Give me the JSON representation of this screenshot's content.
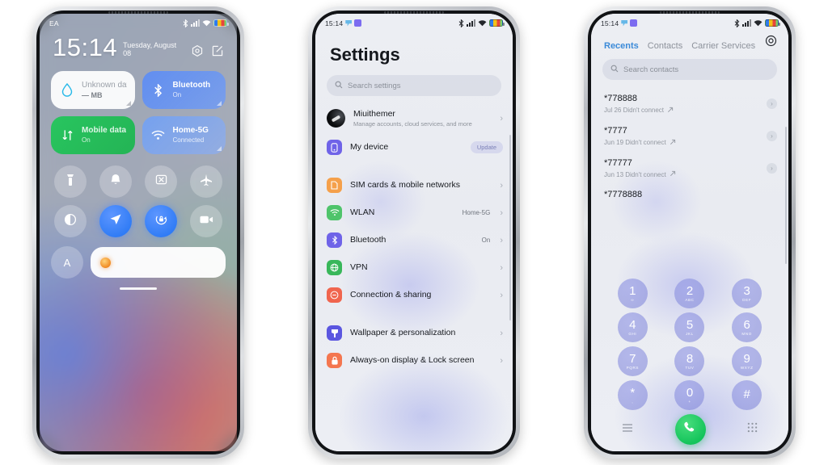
{
  "phone1": {
    "name": "lockscreen-control-center",
    "statusbar": {
      "carrier": "EA",
      "icons": [
        "bluetooth-icon",
        "signal-icon",
        "wifi-icon",
        "battery-icon"
      ]
    },
    "clock": "15:14",
    "date": "Tuesday, August 08",
    "actions": [
      "gear-icon",
      "edit-icon"
    ],
    "tiles": [
      {
        "title": "Unknown data plan",
        "subtitle": "— MB",
        "icon": "water-drop-icon",
        "style": "white"
      },
      {
        "title": "Bluetooth",
        "subtitle": "On",
        "icon": "bluetooth-icon",
        "style": "blue"
      },
      {
        "title": "Mobile data",
        "subtitle": "On",
        "icon": "data-arrows-icon",
        "style": "green"
      },
      {
        "title": "Home-5G",
        "subtitle": "Connected",
        "icon": "wifi-icon",
        "style": "wifi"
      }
    ],
    "toggles": [
      {
        "name": "flashlight-toggle",
        "icon": "flashlight-icon",
        "active": false
      },
      {
        "name": "ringer-toggle",
        "icon": "bell-icon",
        "active": false
      },
      {
        "name": "screenshot-toggle",
        "icon": "screenshot-icon",
        "active": false
      },
      {
        "name": "airplane-toggle",
        "icon": "airplane-icon",
        "active": false
      },
      {
        "name": "dark-mode-toggle",
        "icon": "contrast-icon",
        "active": false
      },
      {
        "name": "location-toggle",
        "icon": "location-arrow-icon",
        "active": true
      },
      {
        "name": "auto-rotate-toggle",
        "icon": "rotate-lock-icon",
        "active": true
      },
      {
        "name": "screen-record-toggle",
        "icon": "video-camera-icon",
        "active": false
      }
    ],
    "auto_brightness_label": "A",
    "brightness_icon": "sun-icon"
  },
  "phone2": {
    "name": "settings-app",
    "statusbar": {
      "time": "15:14",
      "icons": [
        "bluetooth-icon",
        "signal-icon",
        "wifi-icon",
        "battery-icon"
      ]
    },
    "title": "Settings",
    "search": {
      "placeholder": "Search settings",
      "icon": "search-icon"
    },
    "account": {
      "title": "Miuithemer",
      "subtitle": "Manage accounts, cloud services, and more",
      "icon": "avatar-icon"
    },
    "device": {
      "title": "My device",
      "badge": "Update",
      "icon": "phone-icon",
      "color": "#6f63e8"
    },
    "items": [
      {
        "title": "SIM cards & mobile networks",
        "value": "",
        "icon": "sim-icon",
        "color": "#f5a04a"
      },
      {
        "title": "WLAN",
        "value": "Home-5G",
        "icon": "wifi-icon",
        "color": "#4fc46b"
      },
      {
        "title": "Bluetooth",
        "value": "On",
        "icon": "bluetooth-icon",
        "color": "#6f63e8"
      },
      {
        "title": "VPN",
        "value": "",
        "icon": "globe-icon",
        "color": "#39b75a"
      },
      {
        "title": "Connection & sharing",
        "value": "",
        "icon": "share-icon",
        "color": "#f0654e"
      }
    ],
    "items2": [
      {
        "title": "Wallpaper & personalization",
        "value": "",
        "icon": "brush-icon",
        "color": "#5b56e0"
      },
      {
        "title": "Always-on display & Lock screen",
        "value": "",
        "icon": "lock-icon",
        "color": "#f4764f"
      }
    ],
    "chevron": "›"
  },
  "phone3": {
    "name": "phone-dialer-app",
    "statusbar": {
      "time": "15:14",
      "icons": [
        "bluetooth-icon",
        "signal-icon",
        "wifi-icon",
        "battery-icon"
      ]
    },
    "settings_icon": "gear-icon",
    "tabs": [
      {
        "label": "Recents",
        "active": true
      },
      {
        "label": "Contacts",
        "active": false
      },
      {
        "label": "Carrier Services",
        "active": false
      }
    ],
    "search": {
      "placeholder": "Search contacts",
      "icon": "search-icon"
    },
    "calls": [
      {
        "number": "*778888",
        "meta": "Jul 26 Didn't connect",
        "direction_icon": "outgoing-arrow-icon"
      },
      {
        "number": "*7777",
        "meta": "Jun 19 Didn't connect",
        "direction_icon": "outgoing-arrow-icon"
      },
      {
        "number": "*77777",
        "meta": "Jun 13 Didn't connect",
        "direction_icon": "outgoing-arrow-icon"
      },
      {
        "number": "*7778888",
        "meta": "",
        "direction_icon": "outgoing-arrow-icon"
      }
    ],
    "keys": [
      {
        "n": "1",
        "l": "∞"
      },
      {
        "n": "2",
        "l": "ABC"
      },
      {
        "n": "3",
        "l": "DEF"
      },
      {
        "n": "4",
        "l": "GHI"
      },
      {
        "n": "5",
        "l": "JKL"
      },
      {
        "n": "6",
        "l": "MNO"
      },
      {
        "n": "7",
        "l": "PQRS"
      },
      {
        "n": "8",
        "l": "TUV"
      },
      {
        "n": "9",
        "l": "WXYZ"
      },
      {
        "n": "*",
        "l": ","
      },
      {
        "n": "0",
        "l": "+"
      },
      {
        "n": "#",
        "l": " "
      }
    ],
    "bottom": {
      "menu_icon": "menu-icon",
      "call_icon": "phone-call-icon",
      "keypad_icon": "keypad-icon"
    }
  },
  "colors": {
    "accent_blue": "#3b8ad8",
    "call_green": "#13c45a",
    "key_purple": "#7c82d6",
    "tile_green": "#28c55f"
  }
}
